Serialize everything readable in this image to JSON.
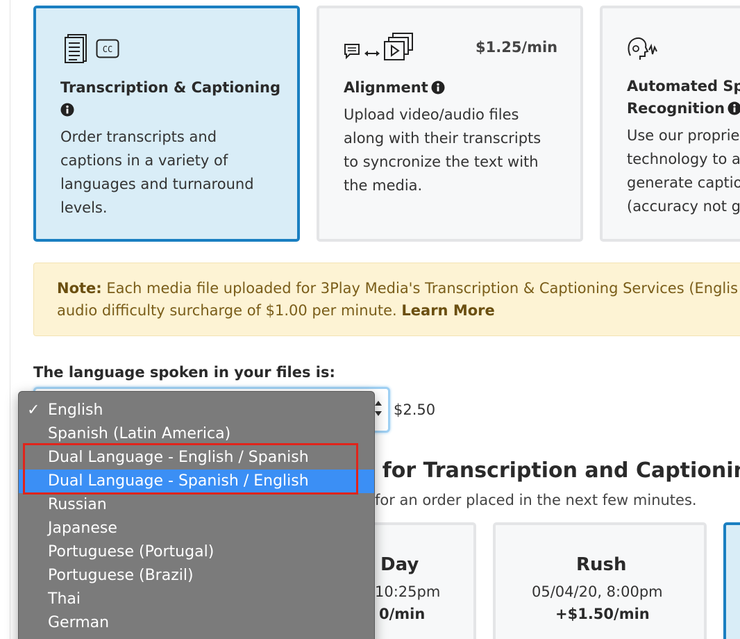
{
  "cards": [
    {
      "title_line1": "Transcription & Captioning",
      "desc_lines": [
        "Order transcripts and",
        "captions in a variety of",
        "languages and turnaround",
        "levels."
      ],
      "icon_names": [
        "document-icon",
        "cc-icon",
        "info-icon"
      ],
      "badge": "CC",
      "selected": true
    },
    {
      "title_line1": "Alignment",
      "price": "$1.25/min",
      "desc_lines": [
        "Upload video/audio files",
        "along with their transcripts",
        "to syncronize the text with",
        "the media."
      ],
      "icon_names": [
        "chat-icon",
        "double-arrow-icon",
        "video-stack-icon",
        "info-icon"
      ]
    },
    {
      "title_line1": "Automated Spe",
      "title_line2": "Recognition",
      "desc_lines": [
        "Use our proprie",
        "technology to a",
        "generate captio",
        "(accuracy not g"
      ],
      "icon_names": [
        "speech-head-icon",
        "info-icon"
      ]
    }
  ],
  "note": {
    "label": "Note:",
    "line1": "Each media file uploaded for 3Play Media's Transcription & Captioning Services (Englis",
    "line2": "audio difficulty surcharge of $1.00 per minute.",
    "link": "Learn More"
  },
  "language": {
    "label": "The language spoken in your files is:",
    "price": "$2.50",
    "options": [
      "English",
      "Spanish (Latin America)",
      "Dual Language - English / Spanish",
      "Dual Language - Spanish / English",
      "Russian",
      "Japanese",
      "Portuguese (Portugal)",
      "Portuguese (Brazil)",
      "Thai",
      "German"
    ],
    "selected_option": "English",
    "highlighted_option": "Dual Language - Spanish / English",
    "checkmark": "✓"
  },
  "turnaround": {
    "heading": "l for Transcription and Captioning",
    "sub": "for an order placed in the next few minutes.",
    "cards": [
      {
        "name": "Day",
        "date": "10:25pm",
        "price": "0/min"
      },
      {
        "name": "Rush",
        "date": "05/04/20, 8:00pm",
        "price": "+$1.50/min"
      }
    ]
  },
  "colors": {
    "selected_card_bg": "#d9edf7",
    "selected_card_border": "#1a7fc1",
    "note_bg": "#fdf3d4",
    "dropdown_bg": "#7b7b7b",
    "highlight": "#3b8ff5",
    "annotation_red": "#e0241b"
  }
}
